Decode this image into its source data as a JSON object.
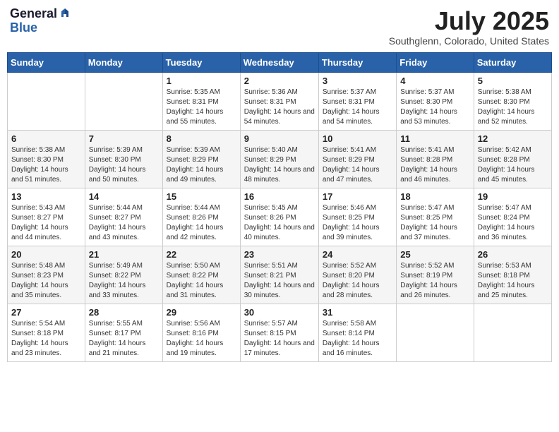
{
  "header": {
    "logo_general": "General",
    "logo_blue": "Blue",
    "month": "July 2025",
    "location": "Southglenn, Colorado, United States"
  },
  "weekdays": [
    "Sunday",
    "Monday",
    "Tuesday",
    "Wednesday",
    "Thursday",
    "Friday",
    "Saturday"
  ],
  "weeks": [
    [
      {
        "day": "",
        "info": ""
      },
      {
        "day": "",
        "info": ""
      },
      {
        "day": "1",
        "info": "Sunrise: 5:35 AM\nSunset: 8:31 PM\nDaylight: 14 hours and 55 minutes."
      },
      {
        "day": "2",
        "info": "Sunrise: 5:36 AM\nSunset: 8:31 PM\nDaylight: 14 hours and 54 minutes."
      },
      {
        "day": "3",
        "info": "Sunrise: 5:37 AM\nSunset: 8:31 PM\nDaylight: 14 hours and 54 minutes."
      },
      {
        "day": "4",
        "info": "Sunrise: 5:37 AM\nSunset: 8:30 PM\nDaylight: 14 hours and 53 minutes."
      },
      {
        "day": "5",
        "info": "Sunrise: 5:38 AM\nSunset: 8:30 PM\nDaylight: 14 hours and 52 minutes."
      }
    ],
    [
      {
        "day": "6",
        "info": "Sunrise: 5:38 AM\nSunset: 8:30 PM\nDaylight: 14 hours and 51 minutes."
      },
      {
        "day": "7",
        "info": "Sunrise: 5:39 AM\nSunset: 8:30 PM\nDaylight: 14 hours and 50 minutes."
      },
      {
        "day": "8",
        "info": "Sunrise: 5:39 AM\nSunset: 8:29 PM\nDaylight: 14 hours and 49 minutes."
      },
      {
        "day": "9",
        "info": "Sunrise: 5:40 AM\nSunset: 8:29 PM\nDaylight: 14 hours and 48 minutes."
      },
      {
        "day": "10",
        "info": "Sunrise: 5:41 AM\nSunset: 8:29 PM\nDaylight: 14 hours and 47 minutes."
      },
      {
        "day": "11",
        "info": "Sunrise: 5:41 AM\nSunset: 8:28 PM\nDaylight: 14 hours and 46 minutes."
      },
      {
        "day": "12",
        "info": "Sunrise: 5:42 AM\nSunset: 8:28 PM\nDaylight: 14 hours and 45 minutes."
      }
    ],
    [
      {
        "day": "13",
        "info": "Sunrise: 5:43 AM\nSunset: 8:27 PM\nDaylight: 14 hours and 44 minutes."
      },
      {
        "day": "14",
        "info": "Sunrise: 5:44 AM\nSunset: 8:27 PM\nDaylight: 14 hours and 43 minutes."
      },
      {
        "day": "15",
        "info": "Sunrise: 5:44 AM\nSunset: 8:26 PM\nDaylight: 14 hours and 42 minutes."
      },
      {
        "day": "16",
        "info": "Sunrise: 5:45 AM\nSunset: 8:26 PM\nDaylight: 14 hours and 40 minutes."
      },
      {
        "day": "17",
        "info": "Sunrise: 5:46 AM\nSunset: 8:25 PM\nDaylight: 14 hours and 39 minutes."
      },
      {
        "day": "18",
        "info": "Sunrise: 5:47 AM\nSunset: 8:25 PM\nDaylight: 14 hours and 37 minutes."
      },
      {
        "day": "19",
        "info": "Sunrise: 5:47 AM\nSunset: 8:24 PM\nDaylight: 14 hours and 36 minutes."
      }
    ],
    [
      {
        "day": "20",
        "info": "Sunrise: 5:48 AM\nSunset: 8:23 PM\nDaylight: 14 hours and 35 minutes."
      },
      {
        "day": "21",
        "info": "Sunrise: 5:49 AM\nSunset: 8:22 PM\nDaylight: 14 hours and 33 minutes."
      },
      {
        "day": "22",
        "info": "Sunrise: 5:50 AM\nSunset: 8:22 PM\nDaylight: 14 hours and 31 minutes."
      },
      {
        "day": "23",
        "info": "Sunrise: 5:51 AM\nSunset: 8:21 PM\nDaylight: 14 hours and 30 minutes."
      },
      {
        "day": "24",
        "info": "Sunrise: 5:52 AM\nSunset: 8:20 PM\nDaylight: 14 hours and 28 minutes."
      },
      {
        "day": "25",
        "info": "Sunrise: 5:52 AM\nSunset: 8:19 PM\nDaylight: 14 hours and 26 minutes."
      },
      {
        "day": "26",
        "info": "Sunrise: 5:53 AM\nSunset: 8:18 PM\nDaylight: 14 hours and 25 minutes."
      }
    ],
    [
      {
        "day": "27",
        "info": "Sunrise: 5:54 AM\nSunset: 8:18 PM\nDaylight: 14 hours and 23 minutes."
      },
      {
        "day": "28",
        "info": "Sunrise: 5:55 AM\nSunset: 8:17 PM\nDaylight: 14 hours and 21 minutes."
      },
      {
        "day": "29",
        "info": "Sunrise: 5:56 AM\nSunset: 8:16 PM\nDaylight: 14 hours and 19 minutes."
      },
      {
        "day": "30",
        "info": "Sunrise: 5:57 AM\nSunset: 8:15 PM\nDaylight: 14 hours and 17 minutes."
      },
      {
        "day": "31",
        "info": "Sunrise: 5:58 AM\nSunset: 8:14 PM\nDaylight: 14 hours and 16 minutes."
      },
      {
        "day": "",
        "info": ""
      },
      {
        "day": "",
        "info": ""
      }
    ]
  ]
}
